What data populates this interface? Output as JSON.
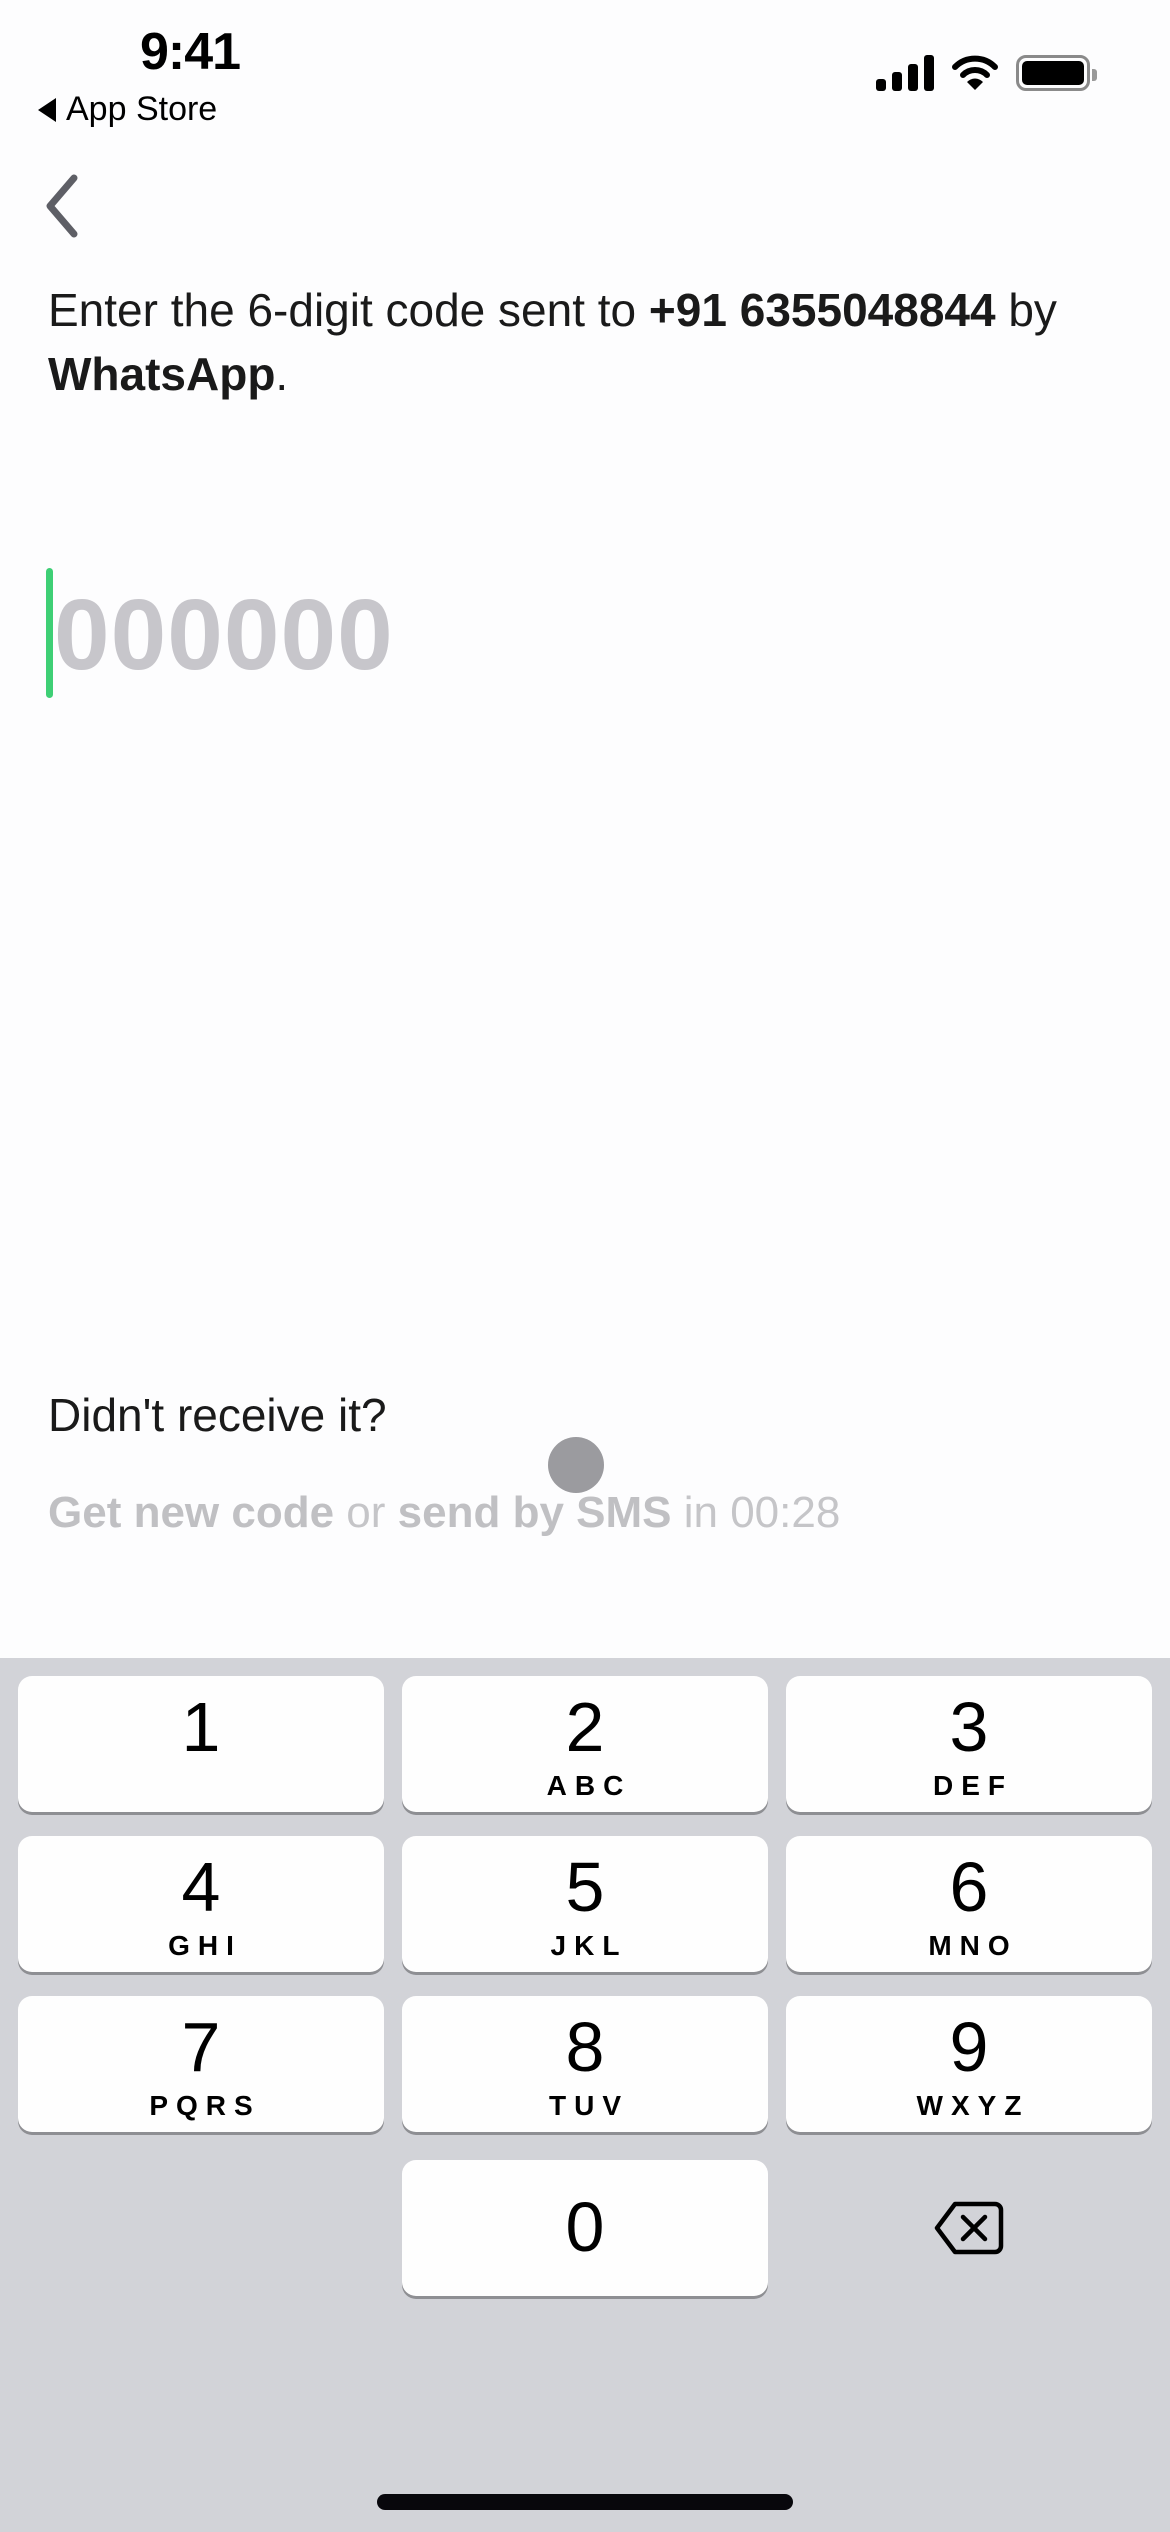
{
  "status_bar": {
    "time": "9:41",
    "back_app_label": "App Store",
    "icons": [
      "cellular-signal-icon",
      "wifi-icon",
      "battery-icon"
    ]
  },
  "nav": {
    "back_icon": "chevron-left-icon"
  },
  "instruction": {
    "prefix": "Enter the 6-digit code sent to ",
    "phone": "+91 6355048844",
    "middle": " by ",
    "channel": "WhatsApp",
    "suffix": "."
  },
  "code_input": {
    "value": "",
    "placeholder": "000000",
    "caret_color": "#3ecf75"
  },
  "resend": {
    "question": "Didn't receive it?",
    "get_new_code": "Get new code",
    "or": " or ",
    "send_by_sms": "send by SMS",
    "in": " in ",
    "countdown": "00:28"
  },
  "keyboard": {
    "keys": [
      {
        "num": "1",
        "letters": ""
      },
      {
        "num": "2",
        "letters": "ABC"
      },
      {
        "num": "3",
        "letters": "DEF"
      },
      {
        "num": "4",
        "letters": "GHI"
      },
      {
        "num": "5",
        "letters": "JKL"
      },
      {
        "num": "6",
        "letters": "MNO"
      },
      {
        "num": "7",
        "letters": "PQRS"
      },
      {
        "num": "8",
        "letters": "TUV"
      },
      {
        "num": "9",
        "letters": "WXYZ"
      },
      {
        "num": "0",
        "letters": ""
      }
    ],
    "delete_icon": "backspace-icon"
  },
  "colors": {
    "accent": "#3ecf75",
    "keyboard_bg": "#d2d3d8",
    "placeholder": "#c7c6cb",
    "disabled_text": "#c5c5c8"
  }
}
